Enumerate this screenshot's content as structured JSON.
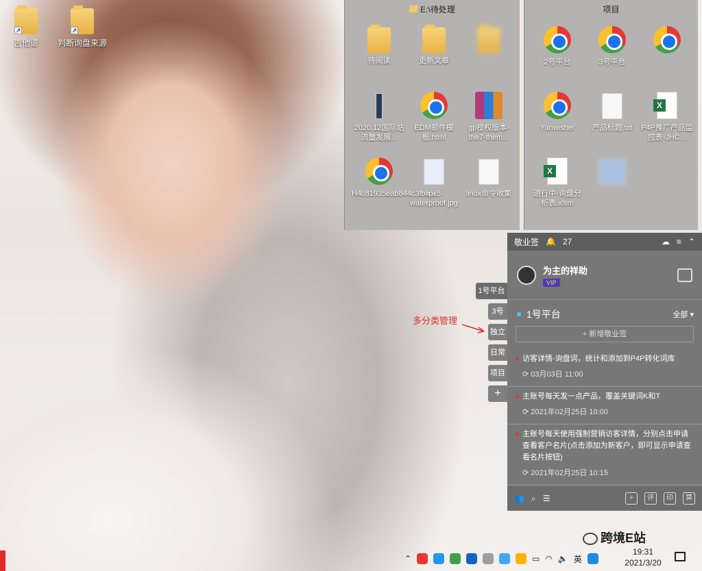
{
  "desktop": {
    "icons": [
      {
        "label": "吉他谱"
      },
      {
        "label": "判断询盘来源"
      }
    ]
  },
  "explorer_left": {
    "title": "E:\\待处理",
    "items": [
      {
        "label": "待阅读",
        "icon": "folder-icon"
      },
      {
        "label": "更新文章",
        "icon": "folder-icon"
      },
      {
        "label": "",
        "icon": "folder-icon"
      },
      {
        "label": "2020.12国际站流量发展...",
        "icon": "image-icon"
      },
      {
        "label": "EDM邮件模板.html",
        "icon": "chrome-icon"
      },
      {
        "label": "gp授权版本-the7-them...",
        "icon": "rar-icon"
      },
      {
        "label": "H4c81935eab844c3fbb...",
        "icon": "chrome-icon"
      },
      {
        "label": "ipx5 waterproof.jpg",
        "icon": "image-icon"
      },
      {
        "label": "linux命令收集",
        "icon": "doc-icon"
      }
    ]
  },
  "explorer_right": {
    "title": "项目",
    "items": [
      {
        "label": "2号平台",
        "icon": "chrome-icon"
      },
      {
        "label": "3号平台",
        "icon": "chrome-icon"
      },
      {
        "label": "",
        "icon": "chrome-icon"
      },
      {
        "label": "Yunwisher",
        "icon": "chrome-icon"
      },
      {
        "label": "产品标题.txt",
        "icon": "doc-icon"
      },
      {
        "label": "P4P推广产品监控表-JHC...",
        "icon": "excel-icon"
      },
      {
        "label": "进行中-询盘分析表.xlsm",
        "icon": "excel-icon"
      },
      {
        "label": "",
        "icon": "image-icon"
      }
    ]
  },
  "sticky_app": {
    "app_name": "敬业签",
    "notify_count": "27",
    "user_name": "为主的祥助",
    "vip": "VIP",
    "category": "1号平台",
    "filter": "全部",
    "add_note": "+ 新增敬业签",
    "notes": [
      {
        "text": "访客详情-询盘词，统计和添加到P4P转化词库",
        "time": "03月03日 11:00"
      },
      {
        "text": "主账号每天发一点产品，覆盖关键词K和T",
        "time": "2021年02月25日 10:00"
      },
      {
        "text": "主账号每天使用强制营销访客详情，分别点击申请查看客户名片(点击添加为新客户，即可显示申请查看名片按钮)",
        "time": "2021年02月25日 10:15"
      }
    ],
    "footer_buttons": [
      "评",
      "印",
      "算"
    ]
  },
  "side_tabs": [
    "1号平台",
    "3号",
    "独立",
    "日常",
    "项目",
    "+"
  ],
  "annotation": "多分类管理",
  "taskbar": {
    "time": "19:31",
    "date": "2021/3/20",
    "ime": "英"
  },
  "watermark": "跨境E站",
  "colors": {
    "accent": "#e53935",
    "panel": "#777777"
  }
}
